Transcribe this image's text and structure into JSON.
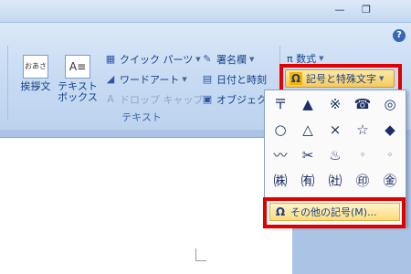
{
  "window": {
    "minimize_label": "—",
    "restore_label": "❐",
    "help_label": "?"
  },
  "ribbon": {
    "group_label": "テキスト",
    "greeting_label": "挨拶文",
    "greeting_icon_text": "おあさつ",
    "textbox_label_1": "テキスト",
    "textbox_label_2": "ボックス",
    "textbox_icon_text": "A≡",
    "quickparts_label": "クイック パーツ",
    "wordart_label": "ワードアート",
    "dropcap_label": "ドロップ キャップ",
    "signature_label": "署名欄",
    "datetime_label": "日付と時刻",
    "object_label": "オブジェクト",
    "equation_label": "π 数式",
    "symbol_button_label": "記号と特殊文字",
    "omega_glyph": "Ω"
  },
  "symbol_popup": {
    "symbols": [
      "〒",
      "▲",
      "※",
      "☎",
      "◎",
      "○",
      "△",
      "×",
      "☆",
      "◆",
      "〰",
      "✂",
      "♨",
      "◦",
      "◦",
      "㈱",
      "㈲",
      "㈳",
      "㊞",
      "㊎"
    ],
    "more_label": "その他の記号(M)..."
  },
  "colors": {
    "highlight_border": "#e00000",
    "ribbon_background": "#c7daf2",
    "hover_gold": "#f8c95a"
  }
}
